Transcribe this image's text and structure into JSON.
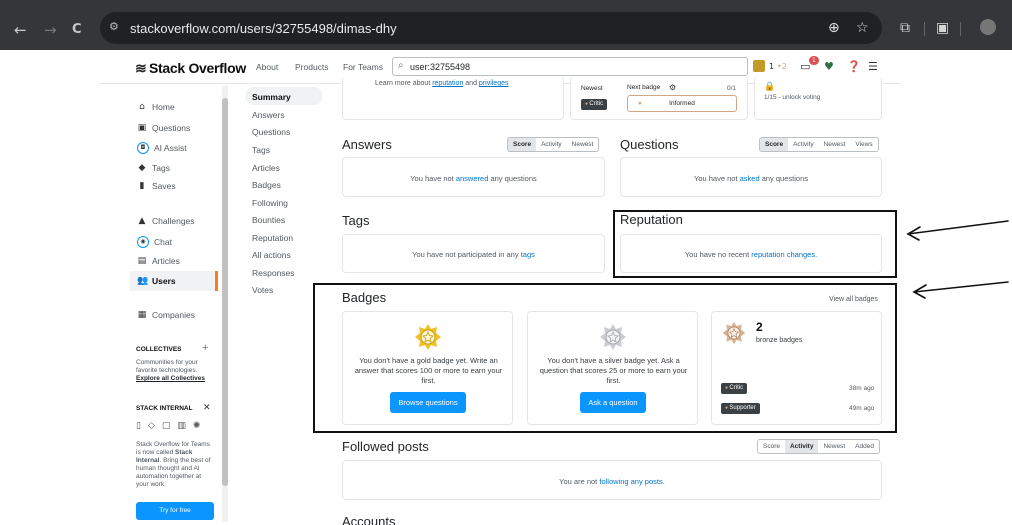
{
  "browser": {
    "back": "←",
    "forward": "→",
    "reload": "C",
    "url": "stackoverflow.com/users/32755498/dimas-dhy"
  },
  "topbar": {
    "logo": "Stack Overflow",
    "about": "About",
    "products": "Products",
    "for_teams": "For Teams",
    "search_value": "user:32755498",
    "rep_count": "1",
    "bronze_dot": "•2",
    "inbox_badge": "1"
  },
  "left_nav": {
    "home": "Home",
    "questions": "Questions",
    "ai_assist": "AI Assist",
    "tags": "Tags",
    "saves": "Saves",
    "challenges": "Challenges",
    "chat": "Chat",
    "articles": "Articles",
    "users": "Users",
    "companies": "Companies",
    "collectives_title": "COLLECTIVES",
    "collectives_add": "+",
    "collectives_desc1": "Communities for your",
    "collectives_desc2": "favorite technologies.",
    "collectives_link": "Explore all Collectives",
    "stack_internal_title": "STACK INTERNAL",
    "stack_internal_close": "✕",
    "si_l1": "Stack Overflow for Teams",
    "si_l2a": "is now called ",
    "si_l2b": "Stack",
    "si_l3a": "Internal",
    "si_l3b": ". Bring the best of",
    "si_l4": "human thought and AI",
    "si_l5": "automation together at",
    "si_l6": "your work.",
    "try_free": "Try for free"
  },
  "profile_nav": [
    "Summary",
    "Answers",
    "Questions",
    "Tags",
    "Articles",
    "Badges",
    "Following",
    "Bounties",
    "Reputation",
    "All actions",
    "Responses",
    "Votes"
  ],
  "top_section": {
    "learn_pre": "Learn more about ",
    "reputation_link": "reputation",
    "learn_and": " and ",
    "privileges_link": "privileges",
    "newest_label": "Newest",
    "critic_tag": "Critic",
    "next_badge_label": "Next badge",
    "next_badge_progress": "0/1",
    "informed_badge": "Informed",
    "unlock_text": "1/15 - unlock voting"
  },
  "answers": {
    "title": "Answers",
    "filters": [
      "Score",
      "Activity",
      "Newest"
    ],
    "msg_pre": "You have not ",
    "msg_link": "answered",
    "msg_post": " any questions"
  },
  "questions": {
    "title": "Questions",
    "filters": [
      "Score",
      "Activity",
      "Newest",
      "Views"
    ],
    "msg_pre": "You have not ",
    "msg_link": "asked",
    "msg_post": " any questions"
  },
  "tags": {
    "title": "Tags",
    "msg_pre": "You have not participated in any ",
    "msg_link": "tags"
  },
  "reputation": {
    "title": "Reputation",
    "msg_pre": "You have no recent ",
    "msg_link": "reputation changes."
  },
  "badges": {
    "title": "Badges",
    "view_all": "View all badges",
    "gold_text": "You don't have a gold badge yet. Write an answer that scores 100 or more to earn your first.",
    "gold_button": "Browse questions",
    "silver_text": "You don't have a silver badge yet. Ask a question that scores 25 or more to earn your first.",
    "silver_button": "Ask a question",
    "bronze_count": "2",
    "bronze_label": "bronze badges",
    "bronze_items": [
      {
        "name": "Critic",
        "time": "38m ago"
      },
      {
        "name": "Supporter",
        "time": "49m ago"
      }
    ]
  },
  "followed_posts": {
    "title": "Followed posts",
    "filters": [
      "Score",
      "Activity",
      "Newest",
      "Added"
    ],
    "msg_pre": "You are not ",
    "msg_link": "following any posts."
  },
  "accounts": {
    "title": "Accounts"
  },
  "colors": {
    "accent": "#f48225",
    "link": "#0074cc",
    "button": "#0a95ff",
    "annotation": "#111111"
  }
}
